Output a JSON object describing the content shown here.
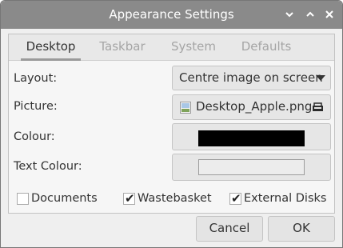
{
  "window": {
    "title": "Appearance Settings",
    "controls": {
      "minimize": "⌄",
      "maximize": "⌃",
      "close": "✕"
    }
  },
  "tabs": [
    {
      "label": "Desktop",
      "active": true
    },
    {
      "label": "Taskbar",
      "active": false
    },
    {
      "label": "System",
      "active": false
    },
    {
      "label": "Defaults",
      "active": false
    }
  ],
  "desktop": {
    "layout": {
      "label": "Layout:",
      "value": "Centre image on screen"
    },
    "picture": {
      "label": "Picture:",
      "value": "Desktop_Apple.png"
    },
    "colour": {
      "label": "Colour:",
      "value": "#000000"
    },
    "text_colour": {
      "label": "Text Colour:",
      "value": "#ececec"
    },
    "checkboxes": [
      {
        "label": "Documents",
        "checked": false
      },
      {
        "label": "Wastebasket",
        "checked": true
      },
      {
        "label": "External Disks",
        "checked": true
      }
    ]
  },
  "buttons": {
    "cancel": "Cancel",
    "ok": "OK"
  },
  "icons": {
    "file": "image-file-icon",
    "open": "open-folder-icon",
    "dropdown": "dropdown-arrow-icon"
  }
}
